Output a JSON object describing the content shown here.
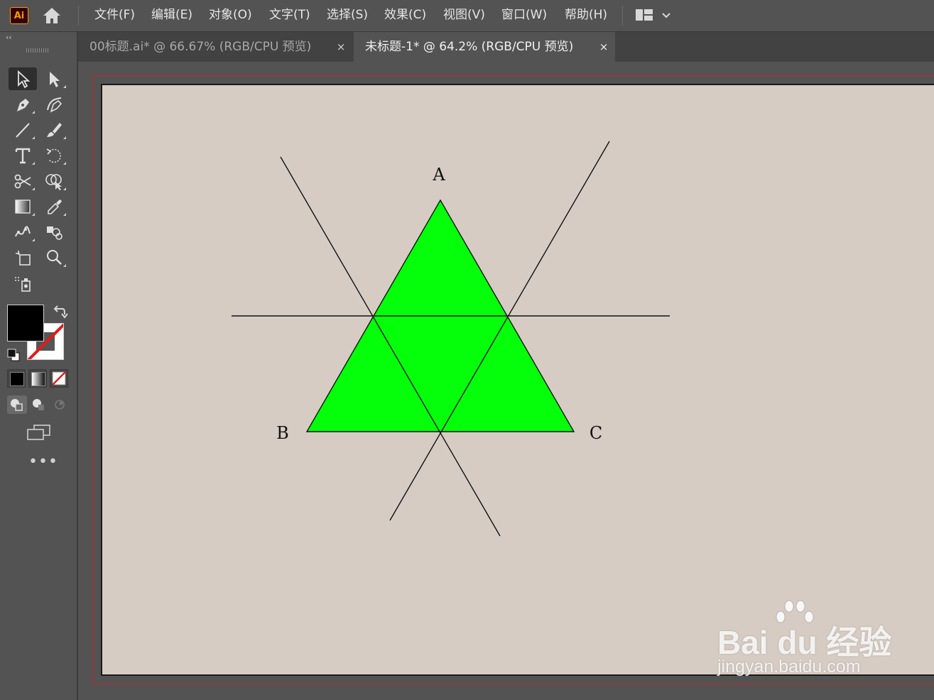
{
  "app": {
    "logo_text": "Ai"
  },
  "menu": [
    "文件(F)",
    "编辑(E)",
    "对象(O)",
    "文字(T)",
    "选择(S)",
    "效果(C)",
    "视图(V)",
    "窗口(W)",
    "帮助(H)"
  ],
  "tabs": [
    {
      "label": "00标题.ai* @ 66.67% (RGB/CPU 预览)",
      "active": false,
      "close": "×"
    },
    {
      "label": "未标题-1* @ 64.2% (RGB/CPU 预览)",
      "active": true,
      "close": "×"
    }
  ],
  "toolbar": {
    "collapse": "‹‹",
    "more": "•••",
    "fill_color": "#000000",
    "stroke": "none"
  },
  "artwork": {
    "triangle_color": "#05ff0b",
    "labels": {
      "a": "A",
      "b": "B",
      "c": "C"
    }
  },
  "colors": {
    "artboard": "#d7ccc3",
    "bleed_guide": "#c4262e",
    "panel": "#535353",
    "accent_logo": "#ff9a00"
  },
  "watermark": {
    "brand": "Bai  du 经验",
    "url": "jingyan.baidu.com"
  }
}
